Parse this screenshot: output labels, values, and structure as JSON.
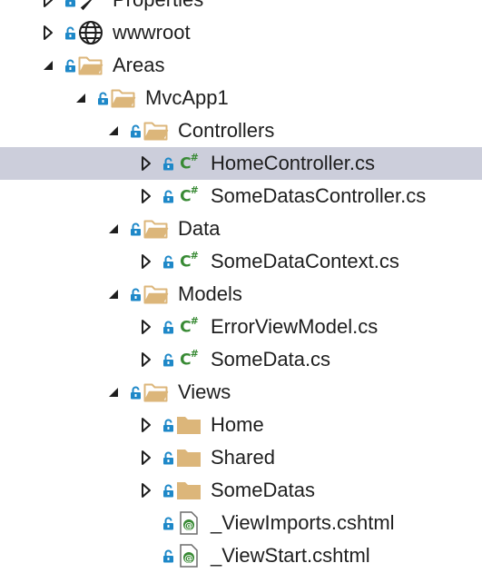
{
  "tree": {
    "items": [
      {
        "label": "Properties",
        "icon": "wrench-icon",
        "expander": "collapsed",
        "depth": 0
      },
      {
        "label": "wwwroot",
        "icon": "globe-icon",
        "expander": "collapsed",
        "depth": 0
      },
      {
        "label": "Areas",
        "icon": "folder-open-icon",
        "expander": "expanded",
        "depth": 0
      },
      {
        "label": "MvcApp1",
        "icon": "folder-open-icon",
        "expander": "expanded",
        "depth": 1
      },
      {
        "label": "Controllers",
        "icon": "folder-open-icon",
        "expander": "expanded",
        "depth": 2
      },
      {
        "label": "HomeController.cs",
        "icon": "csharp-file-icon",
        "expander": "collapsed",
        "depth": 3,
        "selected": true
      },
      {
        "label": "SomeDatasController.cs",
        "icon": "csharp-file-icon",
        "expander": "collapsed",
        "depth": 3
      },
      {
        "label": "Data",
        "icon": "folder-open-icon",
        "expander": "expanded",
        "depth": 2
      },
      {
        "label": "SomeDataContext.cs",
        "icon": "csharp-file-icon",
        "expander": "collapsed",
        "depth": 3
      },
      {
        "label": "Models",
        "icon": "folder-open-icon",
        "expander": "expanded",
        "depth": 2
      },
      {
        "label": "ErrorViewModel.cs",
        "icon": "csharp-file-icon",
        "expander": "collapsed",
        "depth": 3
      },
      {
        "label": "SomeData.cs",
        "icon": "csharp-file-icon",
        "expander": "collapsed",
        "depth": 3
      },
      {
        "label": "Views",
        "icon": "folder-open-icon",
        "expander": "expanded",
        "depth": 2
      },
      {
        "label": "Home",
        "icon": "folder-icon",
        "expander": "collapsed",
        "depth": 3
      },
      {
        "label": "Shared",
        "icon": "folder-icon",
        "expander": "collapsed",
        "depth": 3
      },
      {
        "label": "SomeDatas",
        "icon": "folder-icon",
        "expander": "collapsed",
        "depth": 3
      },
      {
        "label": "_ViewImports.cshtml",
        "icon": "razor-file-icon",
        "expander": "none",
        "depth": 3
      },
      {
        "label": "_ViewStart.cshtml",
        "icon": "razor-file-icon",
        "expander": "none",
        "depth": 3
      }
    ]
  },
  "colors": {
    "selection": "#cccedb",
    "lock": "#1e88c8",
    "folder": "#dcb67a",
    "csharp": "#388a34",
    "text": "#1e1e1e"
  }
}
